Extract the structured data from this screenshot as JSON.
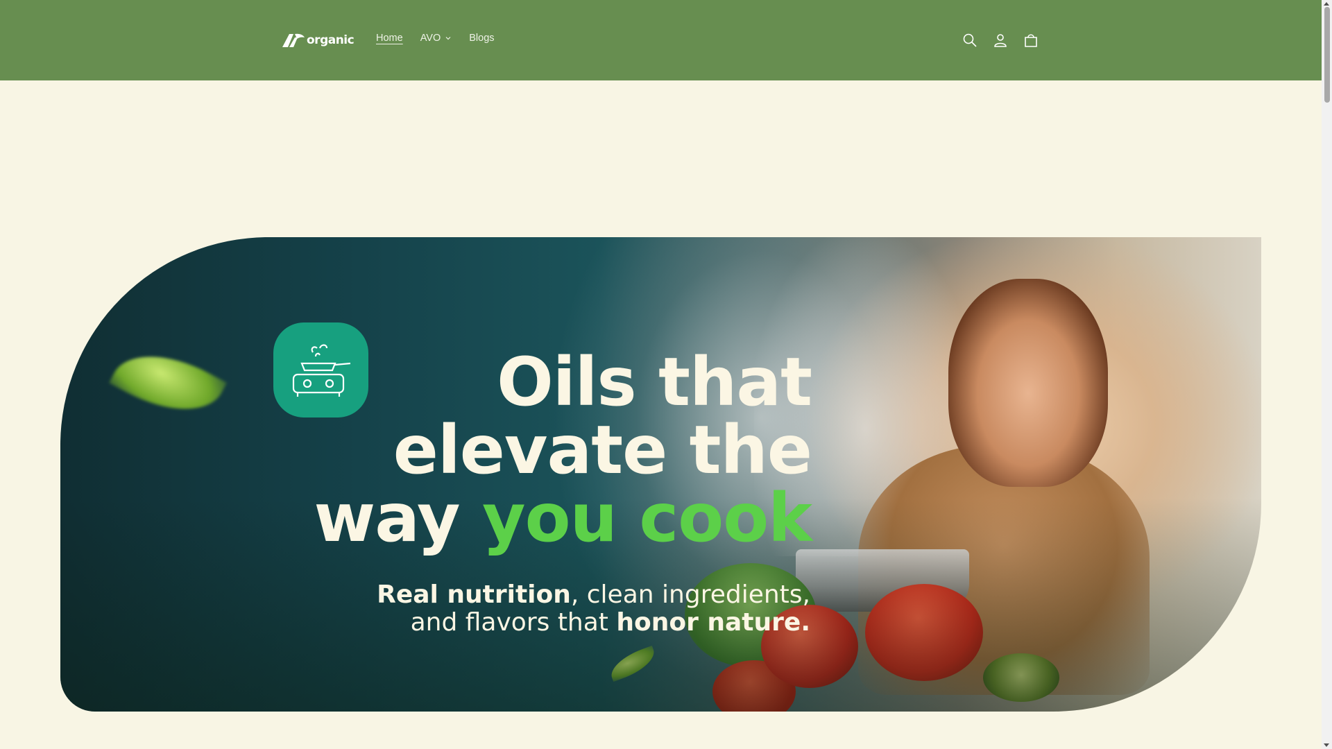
{
  "header": {
    "logo_text": "organic",
    "background_color": "#678e50",
    "nav": [
      {
        "label": "Home",
        "active": true
      },
      {
        "label": "AVO",
        "has_dropdown": true
      },
      {
        "label": "Blogs"
      }
    ],
    "icons": [
      "search-icon",
      "account-icon",
      "cart-icon"
    ]
  },
  "hero": {
    "headline": {
      "line1": "Oils that",
      "line2": "elevate the",
      "line3_part1": "way ",
      "line3_highlight": "you cook"
    },
    "subline": {
      "line1_bold": "Real nutrition",
      "line1_rest": ", clean ingredients,",
      "line2_rest": "and flavors that ",
      "line2_bold": "honor nature."
    },
    "accent_color": "#5cd049",
    "icon_badge_color": "#17a07f",
    "icon": "stove-pan-icon"
  },
  "page": {
    "background_color": "#f8f5e4"
  }
}
